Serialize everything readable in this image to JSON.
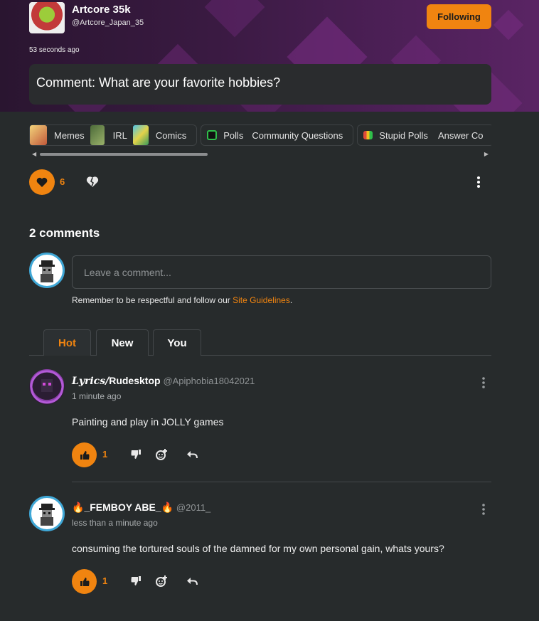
{
  "post": {
    "author_name": "Artcore 35k",
    "author_handle": "@Artcore_Japan_35",
    "follow_label": "Following",
    "time": "53 seconds ago",
    "title": "Comment: What are your favorite hobbies?",
    "like_count": "6"
  },
  "tags": {
    "groups": [
      [
        {
          "label": "Memes",
          "icon": "memes-icon",
          "color": "#d9a84e"
        },
        {
          "label": "IRL",
          "icon": "irl-icon",
          "color": "#6b8f4e"
        },
        {
          "label": "Comics",
          "icon": "comics-icon",
          "color": "#4fc3e8"
        }
      ],
      [
        {
          "label": "Polls",
          "icon": "polls-icon",
          "color": "#2fbf4a"
        },
        {
          "label": "Community Questions",
          "icon": "",
          "color": ""
        }
      ],
      [
        {
          "label": "Stupid Polls",
          "icon": "stupid-polls-icon",
          "color": "#e04a3a"
        },
        {
          "label": "Answer Co",
          "icon": "",
          "color": ""
        }
      ]
    ]
  },
  "comments_section": {
    "title": "2 comments",
    "input_placeholder": "Leave a comment...",
    "guidelines_text": "Remember to be respectful and follow our ",
    "guidelines_link": "Site Guidelines",
    "guidelines_end": "."
  },
  "tabs": [
    {
      "label": "Hot",
      "active": true
    },
    {
      "label": "New",
      "active": false
    },
    {
      "label": "You",
      "active": false
    }
  ],
  "comments": [
    {
      "name_prefix": "𝑳𝒚𝒓𝒊𝒄𝒔/",
      "name": "Rudesktop",
      "handle": "@Apiphobia18042021",
      "time": "1 minute ago",
      "text": "Painting and play in JOLLY games",
      "likes": "1"
    },
    {
      "name_prefix": "🔥",
      "name": "_FEMBOY ABE_🔥",
      "handle": "@2011_",
      "time": "less than a minute ago",
      "text": "consuming the tortured souls of the damned for my own personal gain, whats yours?",
      "likes": "1"
    }
  ],
  "colors": {
    "accent": "#f08410",
    "background": "#272b2c",
    "header": "#4b1f55"
  }
}
